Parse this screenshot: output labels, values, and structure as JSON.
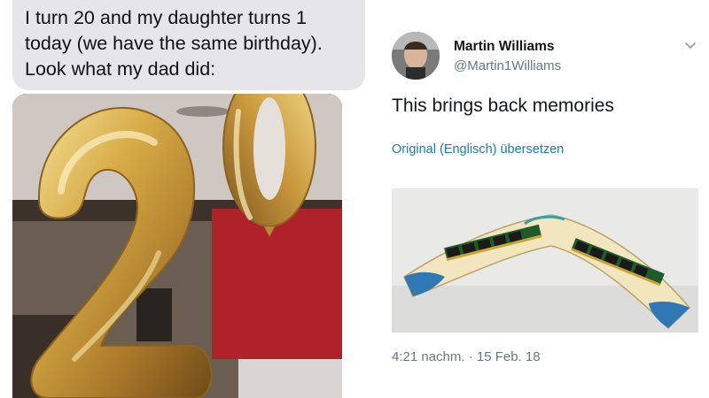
{
  "chat": {
    "message_text": "I turn 20 and my daughter turns 1 today (we have the same birthday). Look what my dad did:"
  },
  "tweet": {
    "author_name": "Martin Williams",
    "author_handle": "@Martin1Williams",
    "text": "This brings back memories",
    "translate_label": "Original (Englisch) übersetzen",
    "timestamp": "4:21 nachm. · 15 Feb. 18"
  },
  "colors": {
    "bubble_bg": "#e5e5ea",
    "link": "#1b7ab8",
    "secondary_text": "#657786",
    "balloon_gold": "#d6aa45"
  },
  "icons": {
    "menu": "chevron-down-icon"
  }
}
